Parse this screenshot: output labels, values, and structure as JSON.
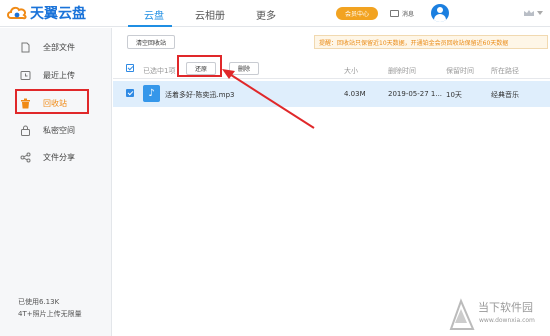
{
  "app": {
    "logo_text": "天翼云盘"
  },
  "nav": {
    "items": [
      {
        "label": "云盘",
        "active": true
      },
      {
        "label": "云相册",
        "active": false
      },
      {
        "label": "更多",
        "active": false
      }
    ],
    "vip_label": "会员中心",
    "messages_label": "消息"
  },
  "sidebar": {
    "items": [
      {
        "label": "全部文件",
        "icon": "file-icon"
      },
      {
        "label": "最近上传",
        "icon": "clock-icon"
      },
      {
        "label": "回收站",
        "icon": "trash-icon",
        "active": true
      },
      {
        "label": "私密空间",
        "icon": "lock-icon"
      },
      {
        "label": "文件分享",
        "icon": "share-icon"
      }
    ],
    "usage": "已使用6.13K",
    "quota": "4T+照片上传无限量"
  },
  "toolbar": {
    "clear_label": "清空回收站",
    "notice": "提醒：回收站只保留近10天数据，开通铂金会员回收站保留近60天数据"
  },
  "table": {
    "selected_text": "已选中1项",
    "restore_label": "还原",
    "delete_label": "删除",
    "columns": {
      "size": "大小",
      "deleted_time": "删除时间",
      "retention": "保留时间",
      "path": "所在路径"
    },
    "rows": [
      {
        "name": "活着多好-陈奕迅.mp3",
        "size": "4.03M",
        "deleted_time": "2019-05-27 1...",
        "retention": "10天",
        "path": "经典音乐",
        "checked": true
      }
    ]
  },
  "watermark": {
    "text": "当下软件园",
    "url": "www.downxia.com"
  },
  "colors": {
    "brand_blue": "#1f8ee3",
    "vip_orange": "#f2a321",
    "active_orange": "#f08a15",
    "highlight_red": "#e0282a",
    "row_selected": "#dfeefc"
  }
}
